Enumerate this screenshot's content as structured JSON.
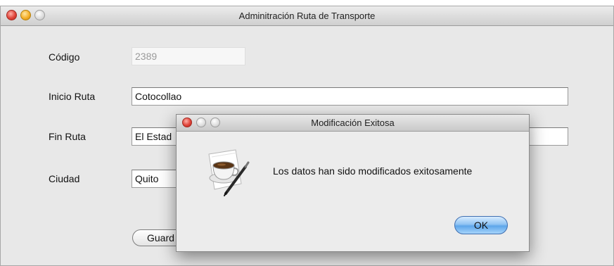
{
  "window": {
    "title": "Adminitración Ruta de Transporte"
  },
  "form": {
    "codigo_label": "Código",
    "codigo_value": "2389",
    "inicio_label": "Inicio Ruta",
    "inicio_value": "Cotocollao",
    "fin_label": "Fin Ruta",
    "fin_value": "El Estad",
    "ciudad_label": "Ciudad",
    "ciudad_value": "Quito",
    "save_label": "Guard"
  },
  "dialog": {
    "title": "Modificación Exitosa",
    "message": "Los datos han sido modificados exitosamente",
    "ok_label": "OK",
    "icon": "coffee-cup-icon"
  }
}
